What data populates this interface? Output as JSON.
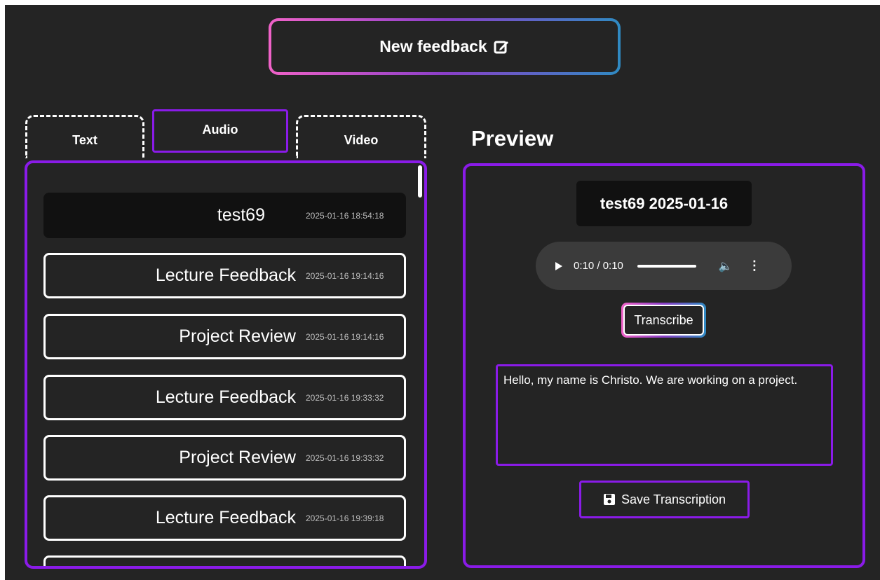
{
  "new_feedback_label": "New feedback",
  "tabs": [
    {
      "label": "Text"
    },
    {
      "label": "Audio"
    },
    {
      "label": "Video"
    }
  ],
  "feedback_items": [
    {
      "title": "test69",
      "timestamp": "2025-01-16 18:54:18"
    },
    {
      "title": "Lecture Feedback",
      "timestamp": "2025-01-16 19:14:16"
    },
    {
      "title": "Project Review",
      "timestamp": "2025-01-16 19:14:16"
    },
    {
      "title": "Lecture Feedback",
      "timestamp": "2025-01-16 19:33:32"
    },
    {
      "title": "Project Review",
      "timestamp": "2025-01-16 19:33:32"
    },
    {
      "title": "Lecture Feedback",
      "timestamp": "2025-01-16 19:39:18"
    }
  ],
  "preview": {
    "heading": "Preview",
    "title": "test69 2025-01-16",
    "audio_time": "0:10 / 0:10",
    "transcribe_label": "Transcribe",
    "transcription": " Hello, my name is Christo. We are working on a project.",
    "save_label": "Save Transcription"
  },
  "colors": {
    "accent": "#8a1be8",
    "background": "#242424",
    "gradient_start": "#f062c8",
    "gradient_end": "#2f8ac2"
  },
  "icons": {
    "new_feedback": "edit-icon",
    "save": "floppy-disk-icon"
  }
}
